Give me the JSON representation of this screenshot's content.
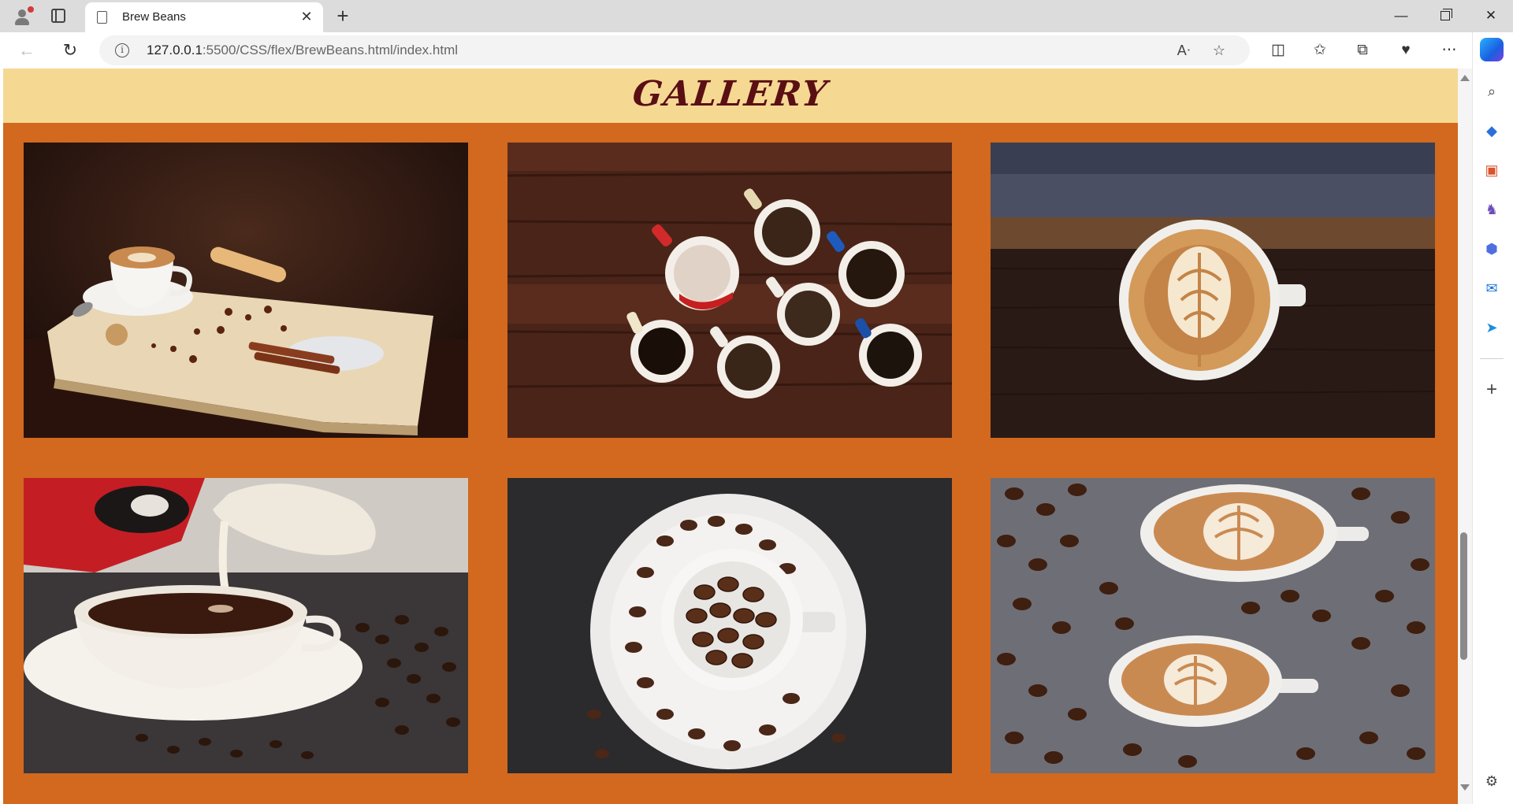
{
  "browser": {
    "tab_title": "Brew Beans",
    "url_host": "127.0.0.1",
    "url_path": ":5500/CSS/flex/BrewBeans.html/index.html",
    "new_tab_symbol": "+",
    "close_tab_symbol": "✕",
    "window_controls": {
      "minimize": "—",
      "close": "✕"
    }
  },
  "page": {
    "title": "Gallery",
    "colors": {
      "header_bg": "#f5d993",
      "title": "#5a0f14",
      "gallery_bg": "#d2691e"
    },
    "gallery": [
      {
        "name": "latte-on-wooden-board",
        "icon": "coffee-photo"
      },
      {
        "name": "espresso-cups-top-view",
        "icon": "coffee-photo"
      },
      {
        "name": "latte-art-cup",
        "icon": "coffee-photo"
      },
      {
        "name": "milk-pouring-into-coffee",
        "icon": "coffee-photo"
      },
      {
        "name": "cup-of-coffee-beans",
        "icon": "coffee-photo"
      },
      {
        "name": "two-lattes-on-beans",
        "icon": "coffee-photo"
      }
    ]
  }
}
